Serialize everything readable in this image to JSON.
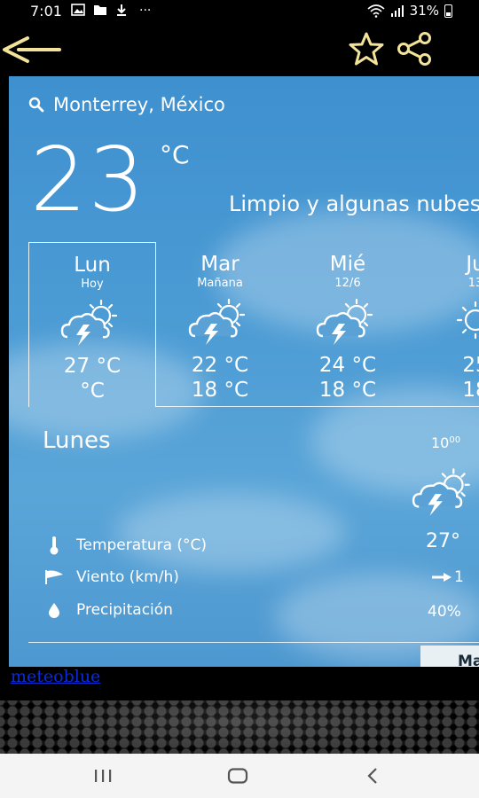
{
  "status_bar": {
    "time": "7:01",
    "more": "···",
    "battery_text": "31%"
  },
  "location": "Monterrey, México",
  "current": {
    "temp": "23",
    "unit": "°C",
    "description": "Limpio y algunas nubes"
  },
  "days": [
    {
      "name": "Lun",
      "sub": "Hoy",
      "max": "27 °C",
      "min": "°C",
      "icon": "thunderstorm-sun-icon"
    },
    {
      "name": "Mar",
      "sub": "Mañana",
      "max": "22 °C",
      "min": "18 °C",
      "icon": "thunderstorm-sun-icon"
    },
    {
      "name": "Mié",
      "sub": "12/6",
      "max": "24 °C",
      "min": "18 °C",
      "icon": "thunderstorm-sun-icon"
    },
    {
      "name": "Ju",
      "sub": "13",
      "max": "25",
      "min": "18",
      "icon": "sun-icon"
    }
  ],
  "detail": {
    "day_title": "Lunes",
    "hour": "10",
    "hour_sup": "00",
    "rows": [
      {
        "label": "Temperatura (°C)",
        "value": "27°",
        "icon": "thermometer-icon"
      },
      {
        "label": "Viento (km/h)",
        "value": "1",
        "icon": "wind-flag-icon"
      },
      {
        "label": "Precipitación",
        "value": "40%",
        "icon": "drop-icon"
      }
    ],
    "tab_partial": "Ma"
  },
  "link": "meteoblue",
  "colors": {
    "sky": "#4b9bd4",
    "accent_icon": "#f3e39a",
    "link": "#0a2bd8"
  }
}
